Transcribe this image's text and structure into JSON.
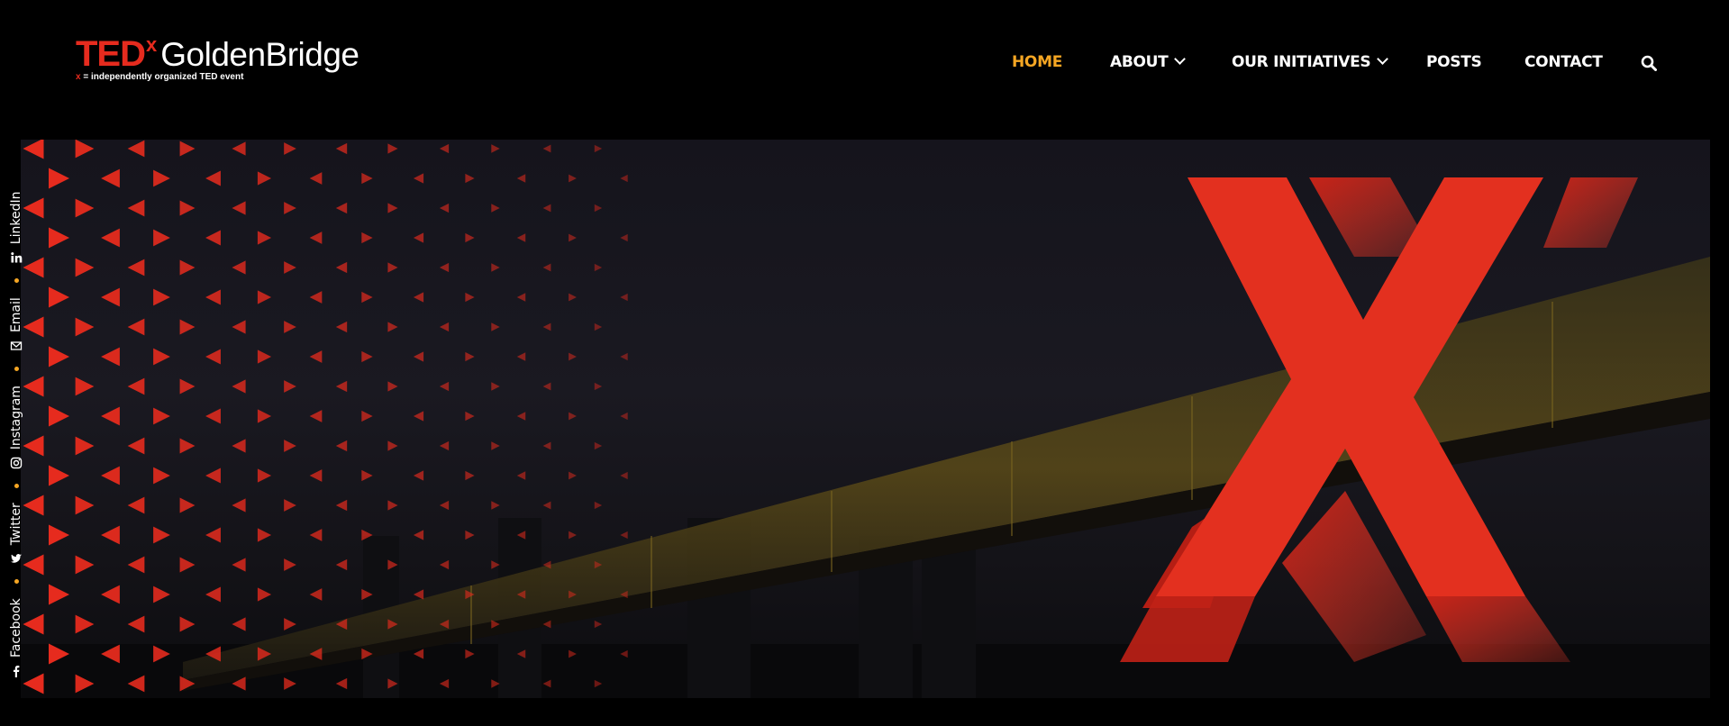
{
  "logo": {
    "ted": "TED",
    "x": "x",
    "name": "GoldenBridge",
    "tag_x": "x",
    "tag_rest": " = independently organized TED event"
  },
  "nav": {
    "items": [
      {
        "label": "HOME",
        "active": true
      },
      {
        "label": "ABOUT",
        "dropdown": true
      },
      {
        "label": "OUR INITIATIVES",
        "dropdown": true
      },
      {
        "label": "POSTS"
      },
      {
        "label": "CONTACT"
      }
    ],
    "search_icon": "search-icon"
  },
  "social": [
    {
      "label": "Facebook",
      "icon": "facebook-icon"
    },
    {
      "label": "Twitter",
      "icon": "twitter-icon"
    },
    {
      "label": "Instagram",
      "icon": "instagram-icon"
    },
    {
      "label": "Email",
      "icon": "email-icon"
    },
    {
      "label": "LinkedIn",
      "icon": "linkedin-icon"
    }
  ],
  "hero": {
    "graphic": "large red 3D X over night bridge with red triangle pattern"
  },
  "colors": {
    "accent": "#f5a623",
    "ted_red": "#e62b1e",
    "background": "#000000"
  }
}
